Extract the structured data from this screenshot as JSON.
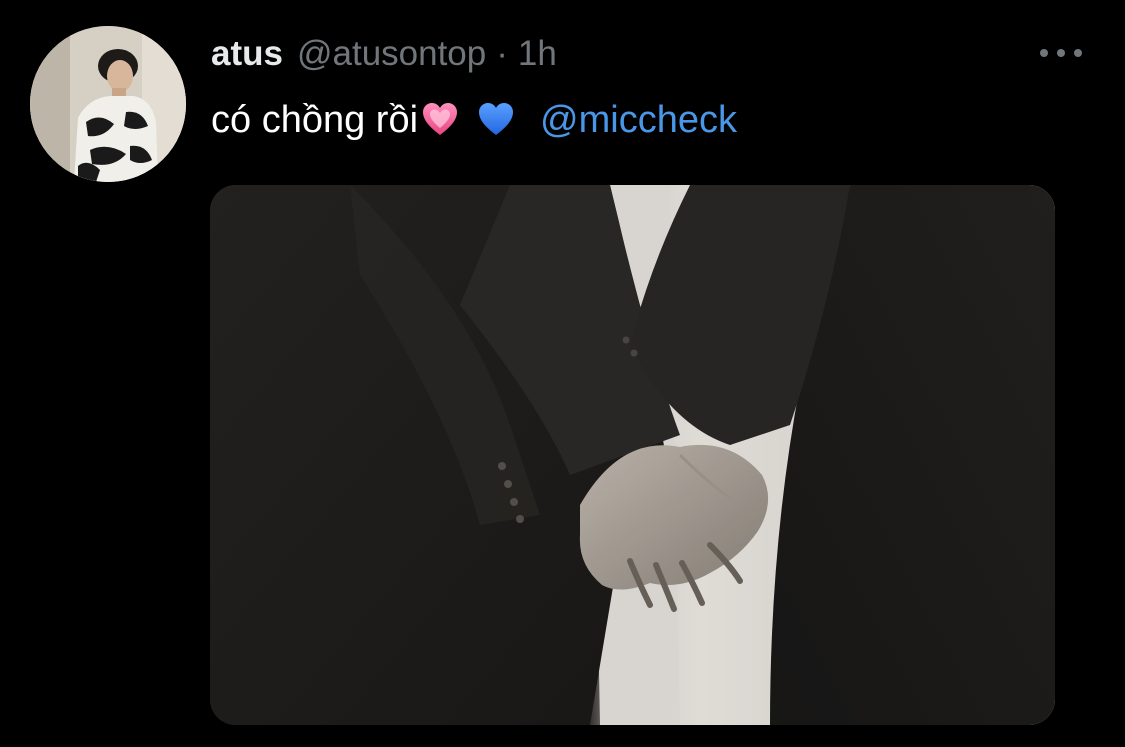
{
  "tweet": {
    "display_name": "atus",
    "handle": "@atusontop",
    "separator": "·",
    "time": "1h",
    "text": "có chồng rồi",
    "emoji_1": "pink-heart",
    "emoji_2": "blue-heart",
    "mention": "@miccheck"
  },
  "colors": {
    "background": "#000000",
    "primary_text": "#e7e9ea",
    "secondary_text": "#71767b",
    "link": "#4a97e8",
    "pink_heart": "#f0679e",
    "blue_heart": "#3b82f6"
  },
  "icons": {
    "more": "more-horizontal-icon",
    "avatar": "avatar"
  }
}
